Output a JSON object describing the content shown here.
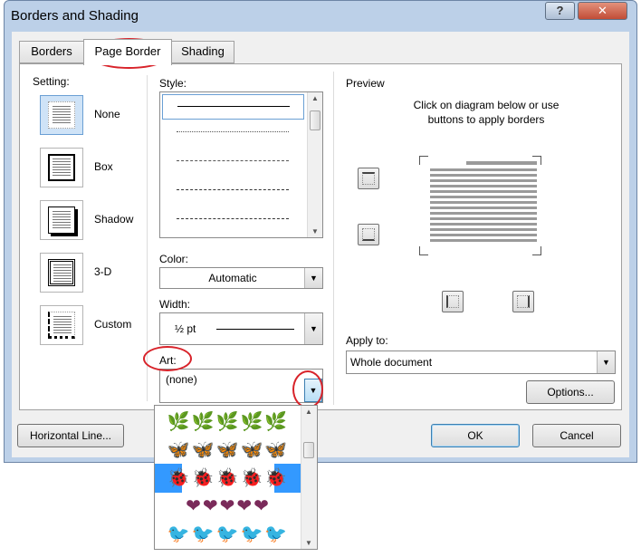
{
  "window": {
    "title": "Borders and Shading",
    "help_label": "?",
    "close_label": "✕"
  },
  "tabs": [
    {
      "label": "Borders"
    },
    {
      "label": "Page Border"
    },
    {
      "label": "Shading"
    }
  ],
  "setting": {
    "heading": "Setting:",
    "options": [
      {
        "label": "None"
      },
      {
        "label": "Box"
      },
      {
        "label": "Shadow"
      },
      {
        "label": "3-D"
      },
      {
        "label": "Custom"
      }
    ]
  },
  "style": {
    "heading": "Style:"
  },
  "color": {
    "heading": "Color:",
    "value": "Automatic"
  },
  "width": {
    "heading": "Width:",
    "value": "½ pt"
  },
  "art": {
    "heading": "Art:",
    "value": "(none)"
  },
  "preview": {
    "heading": "Preview",
    "instruction_line1": "Click on diagram below or use",
    "instruction_line2": "buttons to apply borders"
  },
  "apply_to": {
    "heading": "Apply to:",
    "value": "Whole document"
  },
  "buttons": {
    "options": "Options...",
    "horizontal_line": "Horizontal Line...",
    "ok": "OK",
    "cancel": "Cancel"
  },
  "art_list": {
    "items": [
      {
        "name": "leaf-art",
        "glyphs": "🌿🌿🌿🌿🌿",
        "color": "#2e9a2e"
      },
      {
        "name": "butterfly-art",
        "glyphs": "🦋🦋🦋🦋🦋",
        "color": "#7b2a8f"
      },
      {
        "name": "ladybug-art",
        "glyphs": "🐞🐞🐞🐞🐞",
        "color": "#c0202a"
      },
      {
        "name": "heart-art",
        "glyphs": "❤❤❤❤❤",
        "color": "#7a2a5a"
      },
      {
        "name": "bird-art",
        "glyphs": "🐦🐦🐦🐦🐦",
        "color": "#2b3e8a"
      }
    ],
    "selected_index": 2,
    "selection_color": "#3399ff"
  }
}
